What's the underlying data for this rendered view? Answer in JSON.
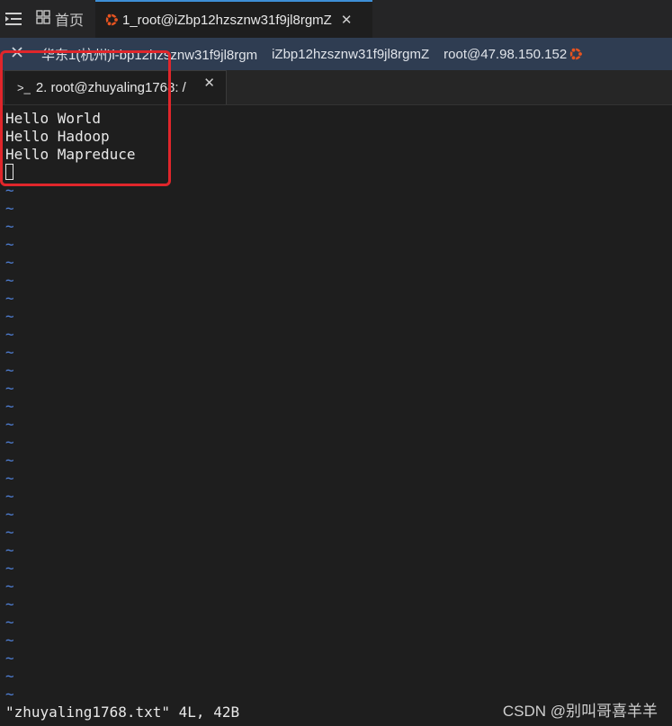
{
  "topbar": {
    "home_label": "首页",
    "session_tab_label": "1_root@iZbp12hzsznw31f9jl8rgmZ",
    "close_glyph": "✕"
  },
  "infobar": {
    "region": "华东1(杭州)i-bp12hzsznw31f9jl8rgm",
    "hostname": "iZbp12hzsznw31f9jl8rgmZ",
    "user_host": "root@47.98.150.152"
  },
  "terminal_tab": {
    "prompt_glyph": ">_",
    "label": "2. root@zhuyaling1768: /",
    "close_glyph": "✕"
  },
  "editor": {
    "lines": [
      "Hello World",
      "Hello Hadoop",
      "Hello Mapreduce"
    ],
    "empty_marker": "~",
    "status": "\"zhuyaling1768.txt\" 4L, 42B"
  },
  "watermark": "CSDN @别叫哥喜羊羊",
  "colors": {
    "accent": "#3d8fd6",
    "info_bar": "#2f3d52",
    "tilde": "#4f7fd6",
    "highlight": "#e0262b",
    "ubuntu_orange": "#e95420"
  }
}
